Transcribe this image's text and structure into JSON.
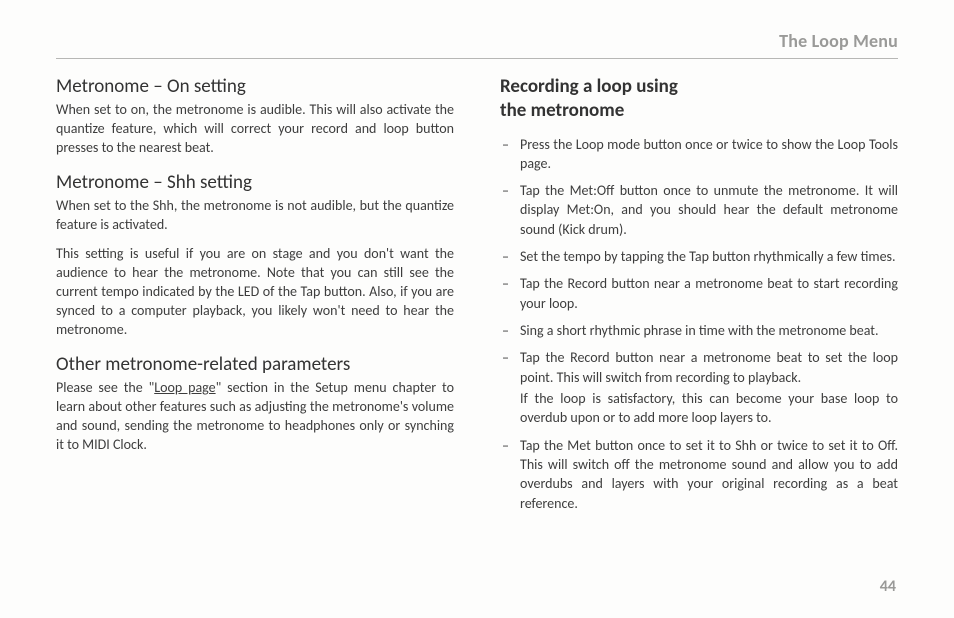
{
  "header": {
    "title": "The Loop Menu"
  },
  "pageNumber": "44",
  "left": {
    "sec1": {
      "heading": "Metronome – On setting",
      "body": "When set to on, the metronome is audible. This will also activate the quantize feature, which will correct your record and loop button presses to the nearest beat."
    },
    "sec2": {
      "heading": "Metronome – Shh setting",
      "body1": "When set to the Shh, the metronome is not audible, but the quantize feature is activated.",
      "body2": "This setting is useful if you are on stage and you don't want the audience to hear the metronome. Note that you can still see the current tempo indicated by the LED of the Tap button. Also, if you are synced to a computer playback, you likely won't need to hear the metronome."
    },
    "sec3": {
      "heading": "Other metronome-related parameters",
      "body_pre": "Please see the \"",
      "link": "Loop page",
      "body_post": "\" section in the Setup menu chapter to learn about other features such as adjusting the metronome's volume and sound, sending the metronome to headphones only or synching it to MIDI Clock."
    }
  },
  "right": {
    "heading_line1": "Recording a loop using",
    "heading_line2": "the metronome",
    "items": [
      {
        "text": "Press the Loop mode button once or twice to show the Loop Tools page."
      },
      {
        "text": "Tap the Met:Off button once to unmute the metronome. It will display Met:On, and you should hear the default metronome sound (Kick drum)."
      },
      {
        "text": "Set the tempo by tapping the Tap button rhythmically a few times."
      },
      {
        "text": "Tap the Record button near a metronome beat to start recording your loop."
      },
      {
        "text": "Sing a short rhythmic phrase in time with the metronome beat."
      },
      {
        "text": "Tap the Record button near a metronome beat to set the loop point. This will switch from recording to playback.",
        "sub": "If the loop is satisfactory, this can become your base loop to overdub upon or to add more loop layers to."
      },
      {
        "text": "Tap the Met button once to set it to Shh or twice to set it to Off. This will switch off the metronome sound and allow you to add overdubs and layers with your original recording as a beat reference."
      }
    ]
  }
}
